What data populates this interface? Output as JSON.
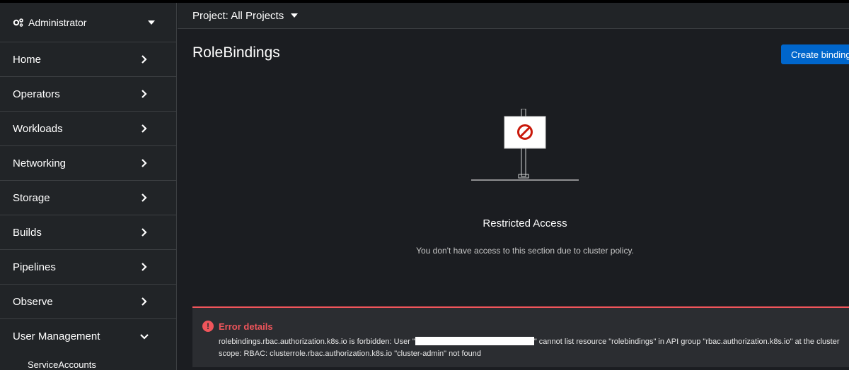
{
  "sidebar": {
    "perspective": {
      "label": "Administrator",
      "icon": "gear-icon"
    },
    "items": [
      {
        "label": "Home",
        "icon": "chevron-right-icon",
        "expanded": false
      },
      {
        "label": "Operators",
        "icon": "chevron-right-icon",
        "expanded": false
      },
      {
        "label": "Workloads",
        "icon": "chevron-right-icon",
        "expanded": false
      },
      {
        "label": "Networking",
        "icon": "chevron-right-icon",
        "expanded": false
      },
      {
        "label": "Storage",
        "icon": "chevron-right-icon",
        "expanded": false
      },
      {
        "label": "Builds",
        "icon": "chevron-right-icon",
        "expanded": false
      },
      {
        "label": "Pipelines",
        "icon": "chevron-right-icon",
        "expanded": false
      },
      {
        "label": "Observe",
        "icon": "chevron-right-icon",
        "expanded": false
      },
      {
        "label": "User Management",
        "icon": "chevron-down-icon",
        "expanded": true
      }
    ],
    "sub_items": [
      {
        "label": "ServiceAccounts"
      }
    ]
  },
  "header": {
    "project_label": "Project: All Projects"
  },
  "main": {
    "title": "RoleBindings",
    "create_button": "Create binding",
    "empty_state": {
      "title": "Restricted Access",
      "body": "You don't have access to this section due to cluster policy."
    },
    "error": {
      "title": "Error details",
      "message_before": "rolebindings.rbac.authorization.k8s.io is forbidden: User \"",
      "message_after": "\" cannot list resource \"rolebindings\" in API group \"rbac.authorization.k8s.io\" at the cluster scope: RBAC: clusterrole.rbac.authorization.k8s.io \"cluster-admin\" not found"
    }
  },
  "colors": {
    "accent": "#0066cc",
    "danger": "#f0555b",
    "background": "#1b1d21",
    "sidebar": "#212427"
  }
}
